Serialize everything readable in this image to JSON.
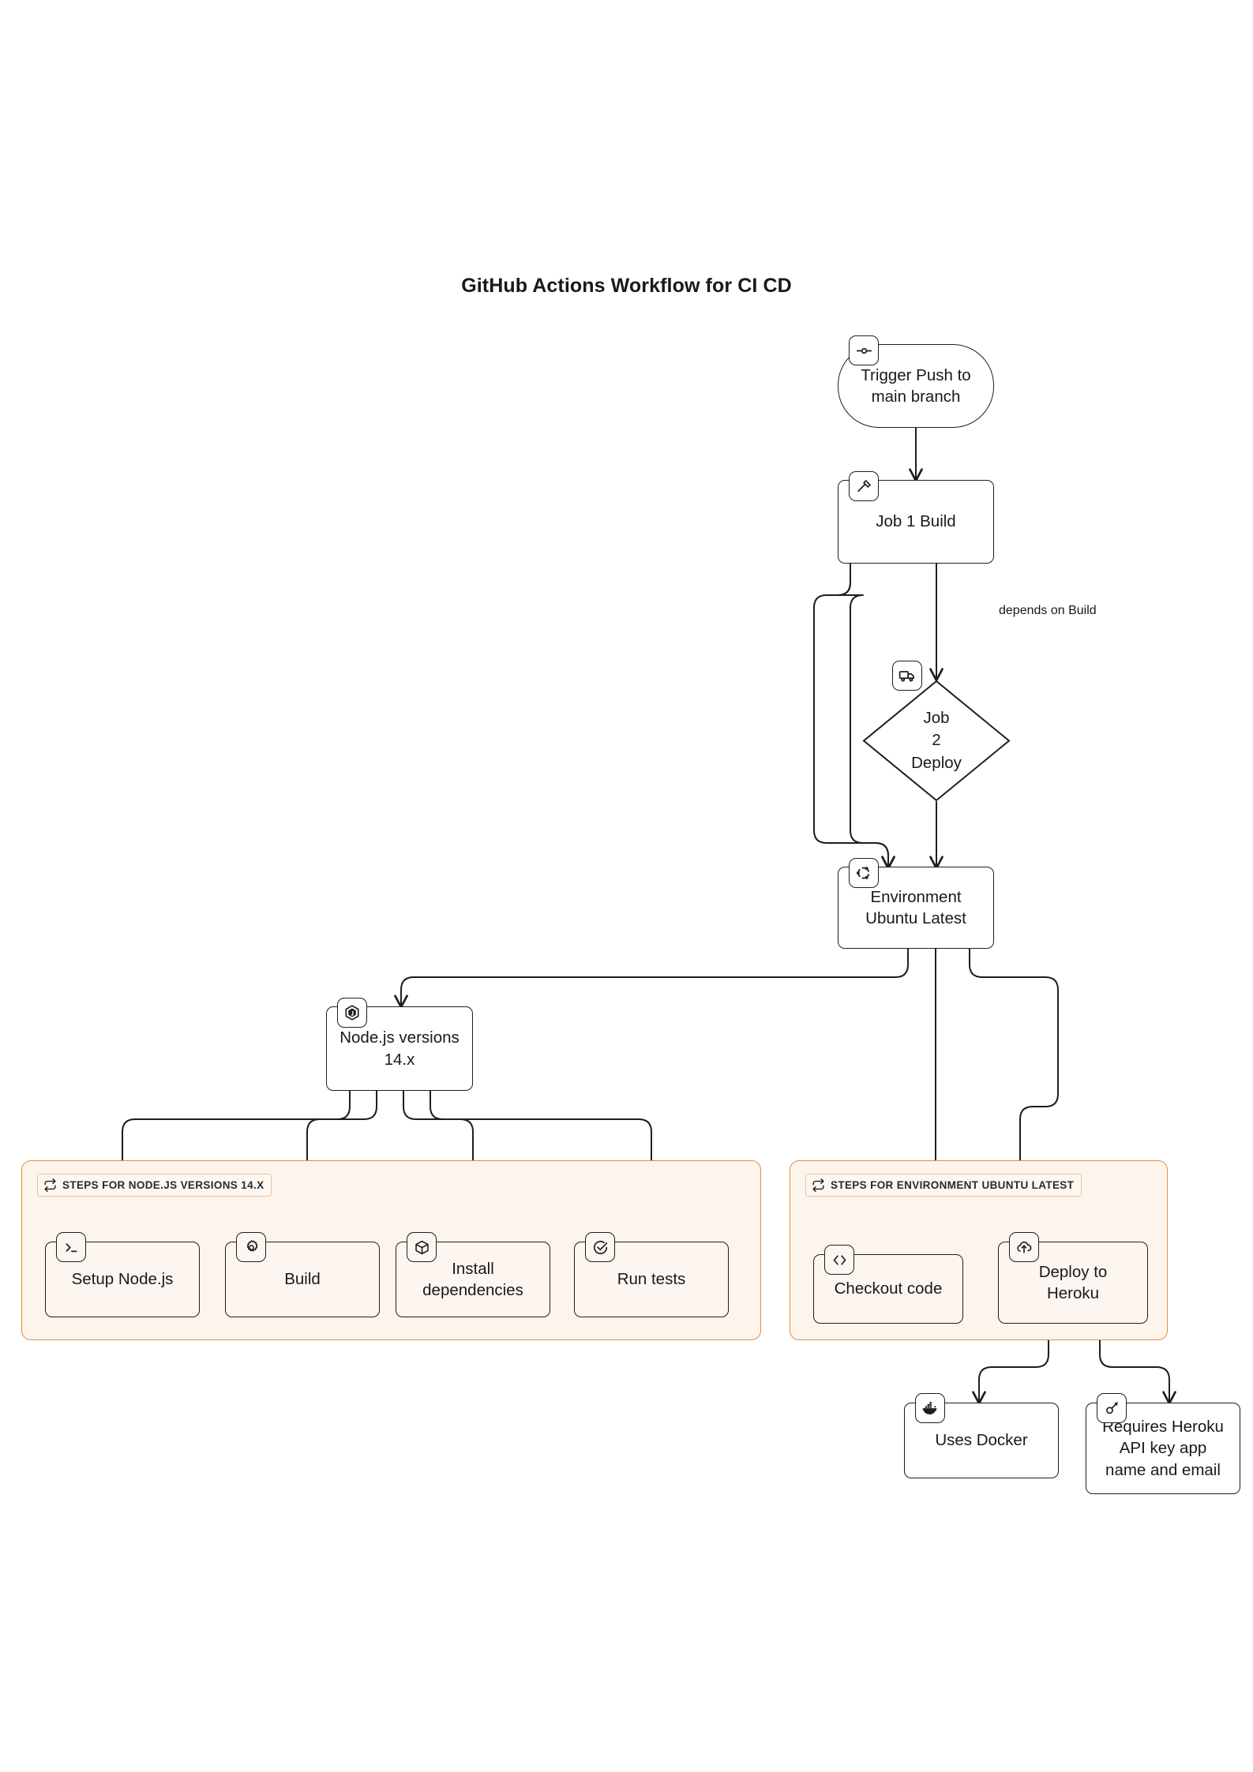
{
  "title": "GitHub Actions Workflow for CI CD",
  "theme": {
    "page_background": "#ffffff",
    "node_stroke": "#1e1e1e",
    "node_fill": "#ffffff",
    "cluster_fill": "#fdf4ec",
    "cluster_stroke": "#e79038",
    "cluster_title_fill": "#fdf7f1",
    "text": "#17191c",
    "edge_stroke": "#1e1e1e"
  },
  "nodes": {
    "trigger": {
      "label": "Trigger Push to main branch",
      "line1": "Trigger Push to",
      "line2": "main branch",
      "shape": "stadium",
      "icon": "git-commit-icon"
    },
    "job1": {
      "label": "Job 1 Build",
      "shape": "rounded-rect",
      "icon": "hammer-icon"
    },
    "job2": {
      "label": "Job 2 Deploy",
      "line1": "Job",
      "line2": "2",
      "line3": "Deploy",
      "shape": "diamond",
      "icon": "truck-icon"
    },
    "environment": {
      "label": "Environment Ubuntu Latest",
      "line1": "Environment",
      "line2": "Ubuntu Latest",
      "shape": "rounded-rect",
      "icon": "ubuntu-icon"
    },
    "nodeversions": {
      "label": "Node.js versions 14.x",
      "line1": "Node.js versions",
      "line2": "14.x",
      "shape": "rounded-rect",
      "icon": "nodejs-icon"
    },
    "setup_node": {
      "label": "Setup Node.js",
      "shape": "rounded-rect",
      "icon": "terminal-icon"
    },
    "build": {
      "label": "Build",
      "shape": "rounded-rect",
      "icon": "gear-icon"
    },
    "install_deps": {
      "label": "Install dependencies",
      "line1": "Install",
      "line2": "dependencies",
      "shape": "rounded-rect",
      "icon": "package-icon"
    },
    "run_tests": {
      "label": "Run tests",
      "shape": "rounded-rect",
      "icon": "check-circle-icon"
    },
    "checkout": {
      "label": "Checkout code",
      "shape": "rounded-rect",
      "icon": "code-brackets-icon"
    },
    "deploy_heroku": {
      "label": "Deploy to Heroku",
      "line1": "Deploy to",
      "line2": "Heroku",
      "shape": "rounded-rect",
      "icon": "cloud-upload-icon"
    },
    "uses_docker": {
      "label": "Uses Docker",
      "shape": "rounded-rect",
      "icon": "docker-icon"
    },
    "requires_heroku": {
      "label": "Requires Heroku API key app name and email",
      "line1": "Requires Heroku",
      "line2": "API key app",
      "line3": "name and email",
      "shape": "rounded-rect",
      "icon": "key-icon"
    }
  },
  "clusters": {
    "node_steps": {
      "title": "STEPS FOR NODE.JS VERSIONS 14.X",
      "icon": "loop-icon"
    },
    "env_steps": {
      "title": "STEPS FOR ENVIRONMENT UBUNTU LATEST",
      "icon": "loop-icon"
    }
  },
  "edge_labels": {
    "depends_on_build": "depends on Build"
  },
  "chart_data": {
    "type": "diagram",
    "diagram_kind": "flowchart",
    "direction": "top-down",
    "title": "GitHub Actions Workflow for CI CD",
    "nodes": [
      {
        "id": "trigger",
        "label": "Trigger Push to main branch",
        "shape": "stadium",
        "icon": "git-commit-icon"
      },
      {
        "id": "job1",
        "label": "Job 1 Build",
        "shape": "rounded-rect",
        "icon": "hammer-icon"
      },
      {
        "id": "job2",
        "label": "Job 2 Deploy",
        "shape": "diamond",
        "icon": "truck-icon"
      },
      {
        "id": "environment",
        "label": "Environment Ubuntu Latest",
        "shape": "rounded-rect",
        "icon": "ubuntu-icon"
      },
      {
        "id": "nodeversions",
        "label": "Node.js versions 14.x",
        "shape": "rounded-rect",
        "icon": "nodejs-icon"
      },
      {
        "id": "setup_node",
        "label": "Setup Node.js",
        "shape": "rounded-rect",
        "icon": "terminal-icon",
        "cluster": "node_steps"
      },
      {
        "id": "build",
        "label": "Build",
        "shape": "rounded-rect",
        "icon": "gear-icon",
        "cluster": "node_steps"
      },
      {
        "id": "install_deps",
        "label": "Install dependencies",
        "shape": "rounded-rect",
        "icon": "package-icon",
        "cluster": "node_steps"
      },
      {
        "id": "run_tests",
        "label": "Run tests",
        "shape": "rounded-rect",
        "icon": "check-circle-icon",
        "cluster": "node_steps"
      },
      {
        "id": "checkout",
        "label": "Checkout code",
        "shape": "rounded-rect",
        "icon": "code-brackets-icon",
        "cluster": "env_steps"
      },
      {
        "id": "deploy_heroku",
        "label": "Deploy to Heroku",
        "shape": "rounded-rect",
        "icon": "cloud-upload-icon",
        "cluster": "env_steps"
      },
      {
        "id": "uses_docker",
        "label": "Uses Docker",
        "shape": "rounded-rect",
        "icon": "docker-icon"
      },
      {
        "id": "requires_heroku",
        "label": "Requires Heroku API key app name and email",
        "shape": "rounded-rect",
        "icon": "key-icon"
      }
    ],
    "clusters": [
      {
        "id": "node_steps",
        "title": "STEPS FOR NODE.JS VERSIONS 14.X",
        "members": [
          "setup_node",
          "build",
          "install_deps",
          "run_tests"
        ]
      },
      {
        "id": "env_steps",
        "title": "STEPS FOR ENVIRONMENT UBUNTU LATEST",
        "members": [
          "checkout",
          "deploy_heroku"
        ]
      }
    ],
    "edges": [
      {
        "from": "trigger",
        "to": "job1",
        "label": ""
      },
      {
        "from": "job1",
        "to": "job2",
        "label": "depends on Build"
      },
      {
        "from": "job1",
        "to": "environment",
        "label": ""
      },
      {
        "from": "job2",
        "to": "environment",
        "label": ""
      },
      {
        "from": "environment",
        "to": "nodeversions",
        "label": ""
      },
      {
        "from": "environment",
        "to": "checkout",
        "label": ""
      },
      {
        "from": "environment",
        "to": "deploy_heroku",
        "label": ""
      },
      {
        "from": "nodeversions",
        "to": "setup_node",
        "label": ""
      },
      {
        "from": "nodeversions",
        "to": "build",
        "label": ""
      },
      {
        "from": "nodeversions",
        "to": "install_deps",
        "label": ""
      },
      {
        "from": "nodeversions",
        "to": "run_tests",
        "label": ""
      },
      {
        "from": "deploy_heroku",
        "to": "uses_docker",
        "label": ""
      },
      {
        "from": "deploy_heroku",
        "to": "requires_heroku",
        "label": ""
      }
    ]
  }
}
